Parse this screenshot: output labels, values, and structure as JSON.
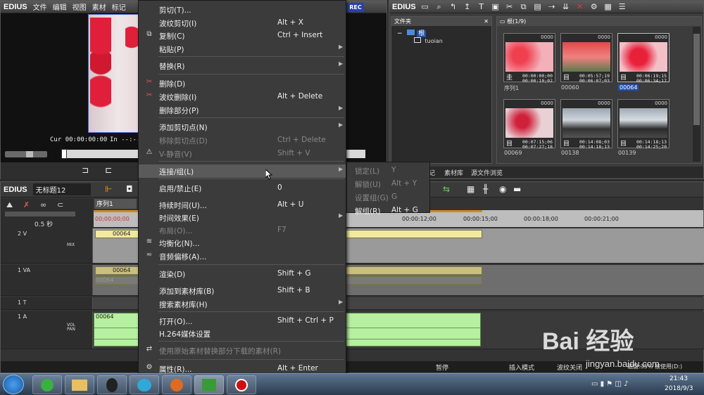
{
  "player": {
    "logo": "EDIUS",
    "menu": [
      "文件",
      "编辑",
      "视图",
      "素材",
      "标记"
    ],
    "rec_badge": "REC",
    "cur_label": "Cur",
    "cur_time": "00:00:00:00",
    "in_label": "In",
    "in_time": "--:--:"
  },
  "bin": {
    "logo": "EDIUS",
    "folder_panel_title": "文件夹",
    "root_folder": "根",
    "sub_folder": "tuoian",
    "content_header": "根(1/9)",
    "tabs": [
      "记",
      "素材库",
      "源文件浏览"
    ],
    "clips": [
      {
        "name": "序列1",
        "num": "0000",
        "tc1": "00:00:00;00",
        "tc2": "00:00:10;02",
        "icon": "seq"
      },
      {
        "name": "00060",
        "num": "0000",
        "tc1": "00:05:57;19",
        "tc2": "00:06:07;03",
        "icon": "clip"
      },
      {
        "name": "00064",
        "num": "0000",
        "tc1": "00:06:19;15",
        "tc2": "00:06:34;17",
        "icon": "clip"
      },
      {
        "name": "00069",
        "num": "0000",
        "tc1": "00:07:15;06",
        "tc2": "00:07:27;18",
        "icon": "clip"
      },
      {
        "name": "00138",
        "num": "0000",
        "tc1": "00:14:08;03",
        "tc2": "00:14:18;13",
        "icon": "clip"
      },
      {
        "name": "00139",
        "num": "0000",
        "tc1": "00:14:18;13",
        "tc2": "00:14:25;20",
        "icon": "clip"
      }
    ]
  },
  "timeline": {
    "logo": "EDIUS",
    "project_name": "无标题12",
    "sequence_tab": "序列1",
    "zoom_label": "0.5 秒",
    "ruler_ticks": [
      "00;00;00;00",
      "00:00:12;00",
      "00:00:15;00",
      "00:00:18;00",
      "00:00:21;00"
    ],
    "tracks": [
      {
        "name": "2 V",
        "mix": "MIX",
        "clip": "00064"
      },
      {
        "name": "1 VA",
        "clip": "00064",
        "clip2": "00064"
      },
      {
        "name": "1 T"
      },
      {
        "name": "1 A",
        "vol": "VOL",
        "pan": "PAN",
        "clip": "00064"
      }
    ],
    "status": {
      "state": "暂停",
      "insert_mode": "插入模式",
      "ripple": "波纹关闭",
      "disk": "磁盘:35% 被使用(D:)"
    }
  },
  "context_menu": {
    "items": [
      {
        "label": "剪切(T)...",
        "shortcut": "",
        "icon": "",
        "disabled": false,
        "arrow": false
      },
      {
        "label": "波纹剪切(I)",
        "shortcut": "Alt + X",
        "icon": "",
        "disabled": false,
        "arrow": false
      },
      {
        "label": "复制(C)",
        "shortcut": "Ctrl + Insert",
        "icon": "copy",
        "disabled": false,
        "arrow": false
      },
      {
        "label": "粘贴(P)",
        "shortcut": "",
        "icon": "",
        "disabled": false,
        "arrow": true
      },
      {
        "label": "替换(R)",
        "shortcut": "",
        "icon": "",
        "disabled": false,
        "arrow": true
      },
      {
        "label": "删除(D)",
        "shortcut": "",
        "icon": "delete",
        "disabled": false,
        "arrow": false
      },
      {
        "label": "波纹删除(I)",
        "shortcut": "Alt + Delete",
        "icon": "ripple-delete",
        "disabled": false,
        "arrow": false
      },
      {
        "label": "删除部分(P)",
        "shortcut": "",
        "icon": "",
        "disabled": false,
        "arrow": true
      },
      {
        "label": "添加剪切点(N)",
        "shortcut": "",
        "icon": "",
        "disabled": false,
        "arrow": true
      },
      {
        "label": "移除剪切点(D)",
        "shortcut": "Ctrl + Delete",
        "icon": "",
        "disabled": true,
        "arrow": false
      },
      {
        "label": "V-静音(V)",
        "shortcut": "Shift + V",
        "icon": "mute",
        "disabled": true,
        "arrow": false
      },
      {
        "label": "连接/组(L)",
        "shortcut": "",
        "icon": "",
        "disabled": false,
        "arrow": true
      },
      {
        "label": "启用/禁止(E)",
        "shortcut": "0",
        "icon": "",
        "disabled": false,
        "arrow": false
      },
      {
        "label": "持续时间(U)...",
        "shortcut": "Alt + U",
        "icon": "",
        "disabled": false,
        "arrow": false
      },
      {
        "label": "时间效果(E)",
        "shortcut": "",
        "icon": "",
        "disabled": false,
        "arrow": true
      },
      {
        "label": "布局(O)...",
        "shortcut": "F7",
        "icon": "",
        "disabled": true,
        "arrow": false
      },
      {
        "label": "均衡化(N)...",
        "shortcut": "",
        "icon": "normalize",
        "disabled": false,
        "arrow": false
      },
      {
        "label": "音频偏移(A)...",
        "shortcut": "",
        "icon": "audio-offset",
        "disabled": false,
        "arrow": false
      },
      {
        "label": "渲染(D)",
        "shortcut": "Shift + G",
        "icon": "",
        "disabled": false,
        "arrow": false
      },
      {
        "label": "添加到素材库(B)",
        "shortcut": "Shift + B",
        "icon": "",
        "disabled": false,
        "arrow": false
      },
      {
        "label": "搜索素材库(H)",
        "shortcut": "",
        "icon": "",
        "disabled": false,
        "arrow": true
      },
      {
        "label": "打开(O)...",
        "shortcut": "Shift + Ctrl + P",
        "icon": "",
        "disabled": false,
        "arrow": false
      },
      {
        "label": "H.264媒体设置",
        "shortcut": "",
        "icon": "",
        "disabled": false,
        "arrow": false
      },
      {
        "label": "使用原始素材替换部分下载的素材(R)",
        "shortcut": "",
        "icon": "replace",
        "disabled": true,
        "arrow": false
      },
      {
        "label": "属性(R)...",
        "shortcut": "Alt + Enter",
        "icon": "properties",
        "disabled": false,
        "arrow": false
      }
    ],
    "submenu": [
      {
        "label": "锁定(L)",
        "shortcut": "Y",
        "disabled": true
      },
      {
        "label": "解锁(U)",
        "shortcut": "Alt + Y",
        "disabled": true
      },
      {
        "label": "设置组(G)",
        "shortcut": "G",
        "disabled": true
      },
      {
        "label": "解组(R)",
        "shortcut": "Alt + G",
        "disabled": false
      }
    ]
  },
  "taskbar": {
    "time": "21:43",
    "date": "2018/9/3"
  },
  "watermark": {
    "brand": "Bai 经验",
    "url": "jingyan.baidu.com"
  }
}
